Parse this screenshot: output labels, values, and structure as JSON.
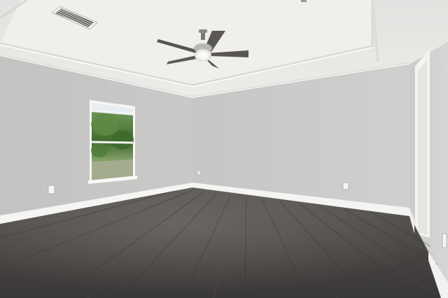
{
  "scene": {
    "type": "photograph",
    "subject": "empty-room",
    "colors": {
      "wall_left": "#c7c8c6",
      "wall_back": "#cbcccb",
      "wall_right": "#d2d3d1",
      "ceiling": "#e8e8e6",
      "ceiling_tray": "#ededeb",
      "trim": "#f4f4f2",
      "floor_dark": "#3d3b3a",
      "floor_mid": "#524f4d",
      "floor_light": "#6f6c69",
      "window_sky": "#e6eef2",
      "window_foliage": "#4d7a3a",
      "fan_blade": "#5b5754",
      "fan_light": "#fbfbf6"
    },
    "icons": [
      "ceiling-fan-icon",
      "air-vent-icon",
      "window-icon",
      "door-frame-icon",
      "power-outlet-icon"
    ]
  }
}
